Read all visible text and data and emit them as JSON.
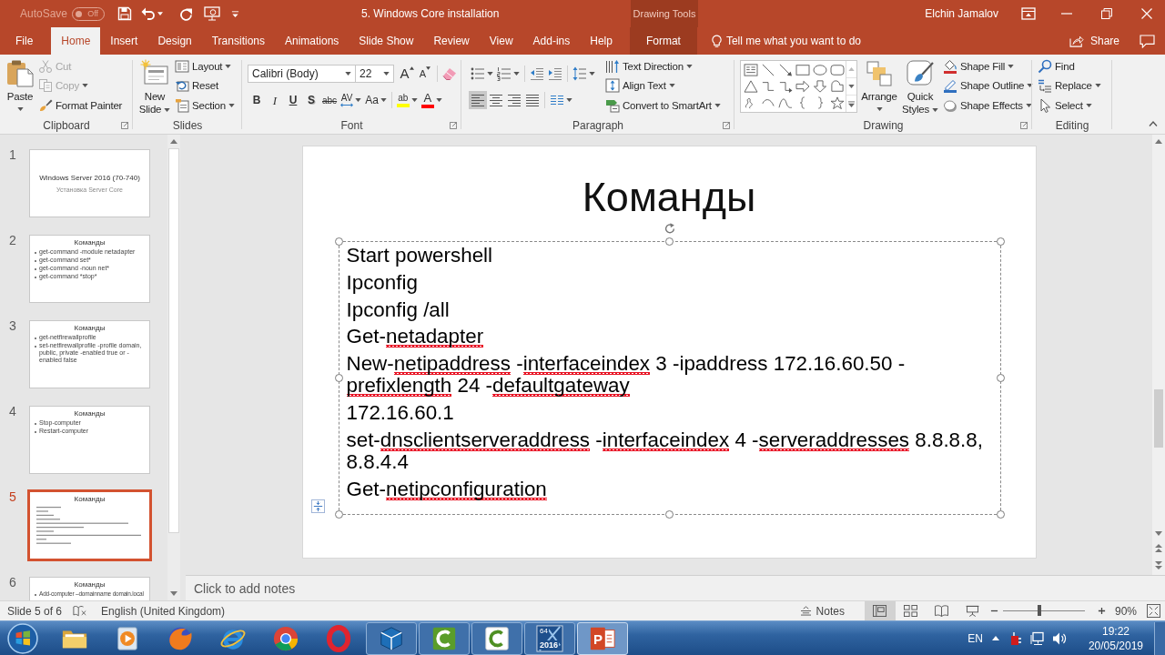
{
  "title_bar": {
    "autosave": {
      "label": "AutoSave",
      "state": "Off",
      "on": false
    },
    "title": "5. Windows Core installation",
    "context_header": "Drawing Tools",
    "user": "Elchin Jamalov"
  },
  "tabs": [
    {
      "label": "File",
      "selected": false,
      "contextual": false
    },
    {
      "label": "Home",
      "selected": true,
      "contextual": false
    },
    {
      "label": "Insert",
      "selected": false,
      "contextual": false
    },
    {
      "label": "Design",
      "selected": false,
      "contextual": false
    },
    {
      "label": "Transitions",
      "selected": false,
      "contextual": false
    },
    {
      "label": "Animations",
      "selected": false,
      "contextual": false
    },
    {
      "label": "Slide Show",
      "selected": false,
      "contextual": false
    },
    {
      "label": "Review",
      "selected": false,
      "contextual": false
    },
    {
      "label": "View",
      "selected": false,
      "contextual": false
    },
    {
      "label": "Add-ins",
      "selected": false,
      "contextual": false
    },
    {
      "label": "Help",
      "selected": false,
      "contextual": false
    },
    {
      "label": "Format",
      "selected": false,
      "contextual": true
    }
  ],
  "tell_me": {
    "placeholder": "Tell me what you want to do"
  },
  "share": {
    "label": "Share"
  },
  "ribbon": {
    "groups": [
      {
        "label": "Clipboard",
        "launcher": true,
        "items": [
          {
            "kind": "large",
            "label": "Paste",
            "dropdown": true,
            "disabled": false
          },
          {
            "kind": "small",
            "label": "Cut",
            "dropdown": false,
            "disabled": true
          },
          {
            "kind": "small",
            "label": "Copy",
            "dropdown": true,
            "disabled": true
          },
          {
            "kind": "small",
            "label": "Format Painter",
            "dropdown": false,
            "disabled": false
          }
        ]
      },
      {
        "label": "Slides",
        "launcher": false,
        "items": [
          {
            "kind": "large",
            "label": "New Slide",
            "dropdown": true
          },
          {
            "kind": "small",
            "label": "Layout",
            "dropdown": true
          },
          {
            "kind": "small",
            "label": "Reset",
            "dropdown": false
          },
          {
            "kind": "small",
            "label": "Section",
            "dropdown": true
          }
        ]
      },
      {
        "label": "Font",
        "launcher": true,
        "items": [
          {
            "kind": "combo",
            "value": "Calibri (Body)",
            "dropdown": true
          },
          {
            "kind": "combo",
            "value": "22",
            "dropdown": true
          },
          {
            "kind": "glyph",
            "text": "A",
            "dropdown": false,
            "selected": false
          },
          {
            "kind": "glyph",
            "text": "A",
            "dropdown": false,
            "selected": false
          },
          {
            "kind": "icon",
            "dropdown": false,
            "selected": false
          },
          {
            "kind": "glyph",
            "text": "B",
            "dropdown": false,
            "selected": false
          },
          {
            "kind": "glyph",
            "text": "I",
            "dropdown": false,
            "selected": false
          },
          {
            "kind": "glyph",
            "text": "U",
            "dropdown": false,
            "selected": false
          },
          {
            "kind": "glyph",
            "text": "S",
            "dropdown": false,
            "selected": false
          },
          {
            "kind": "glyph",
            "text": "abc",
            "dropdown": false,
            "selected": false
          },
          {
            "kind": "glyph",
            "text": "AV",
            "dropdown": true,
            "selected": false
          },
          {
            "kind": "glyph",
            "text": "Aa",
            "dropdown": true,
            "selected": false
          },
          {
            "kind": "glyph",
            "text": "ab",
            "dropdown": true,
            "selected": false,
            "color": "#ffff00"
          },
          {
            "kind": "glyph",
            "text": "A",
            "dropdown": true,
            "selected": false,
            "color": "#ff0000"
          }
        ]
      },
      {
        "label": "Paragraph",
        "launcher": true,
        "items": [
          {
            "kind": "icon",
            "dropdown": true,
            "selected": false
          },
          {
            "kind": "icon",
            "dropdown": true,
            "selected": false
          },
          {
            "kind": "icon",
            "dropdown": false,
            "selected": false
          },
          {
            "kind": "icon",
            "dropdown": false,
            "selected": false
          },
          {
            "kind": "icon",
            "dropdown": true,
            "selected": false
          },
          {
            "kind": "icon",
            "dropdown": false,
            "selected": true
          },
          {
            "kind": "icon",
            "dropdown": false,
            "selected": false
          },
          {
            "kind": "icon",
            "dropdown": false,
            "selected": false
          },
          {
            "kind": "icon",
            "dropdown": false,
            "selected": false
          },
          {
            "kind": "icon",
            "dropdown": true,
            "selected": false
          },
          {
            "kind": "small",
            "label": "Text Direction",
            "dropdown": true
          },
          {
            "kind": "small",
            "label": "Align Text",
            "dropdown": true
          },
          {
            "kind": "small",
            "label": "Convert to SmartArt",
            "dropdown": true
          }
        ]
      },
      {
        "label": "Drawing",
        "launcher": true,
        "items": [
          {
            "kind": "gallery"
          },
          {
            "kind": "large",
            "label": "Arrange",
            "dropdown": true
          },
          {
            "kind": "large",
            "label": "Quick Styles",
            "dropdown": true
          },
          {
            "kind": "small",
            "label": "Shape Fill",
            "dropdown": true
          },
          {
            "kind": "small",
            "label": "Shape Outline",
            "dropdown": true
          },
          {
            "kind": "small",
            "label": "Shape Effects",
            "dropdown": true
          }
        ]
      },
      {
        "label": "Editing",
        "launcher": false,
        "items": [
          {
            "kind": "small",
            "label": "Find",
            "dropdown": false
          },
          {
            "kind": "small",
            "label": "Replace",
            "dropdown": true
          },
          {
            "kind": "small",
            "label": "Select",
            "dropdown": true
          }
        ]
      }
    ]
  },
  "slides_pane": {
    "slides": [
      {
        "number": "1",
        "selected": false,
        "kind": "title",
        "title": "Windows Server 2016 (70-740)",
        "subtitle": "Установка Server Core"
      },
      {
        "number": "2",
        "selected": false,
        "kind": "bullets",
        "title": "Команды",
        "lines": [
          "get-command -module netadapter",
          "get-command set*",
          "get-command -noun net*",
          "get-command *stop*"
        ]
      },
      {
        "number": "3",
        "selected": false,
        "kind": "bullets",
        "title": "Команды",
        "lines": [
          "get-netfirewallprofile",
          "set-netfirewallprofile -profile domain, public, private -enabled true or -enabled false"
        ]
      },
      {
        "number": "4",
        "selected": false,
        "kind": "bullets",
        "title": "Команды",
        "lines": [
          "Stop-computer",
          "Restart-computer"
        ]
      },
      {
        "number": "5",
        "selected": true,
        "kind": "plain",
        "title": "Команды"
      },
      {
        "number": "6",
        "selected": false,
        "kind": "bullets",
        "title": "Команды",
        "lines": [
          "Add-computer –domainname domain.local"
        ]
      }
    ]
  },
  "slide": {
    "title": "Команды",
    "text_box": {
      "selected": true,
      "paragraphs": [
        {
          "lines": [
            {
              "segments": [
                {
                  "text": "Start powershell",
                  "misspelled": false
                }
              ]
            }
          ]
        },
        {
          "lines": [
            {
              "segments": [
                {
                  "text": "Ipconfig",
                  "misspelled": false
                }
              ]
            }
          ]
        },
        {
          "lines": [
            {
              "segments": [
                {
                  "text": "Ipconfig /all",
                  "misspelled": false
                }
              ]
            }
          ]
        },
        {
          "lines": [
            {
              "segments": [
                {
                  "text": "Get-",
                  "misspelled": false
                },
                {
                  "text": "netadapter",
                  "misspelled": true
                }
              ]
            }
          ]
        },
        {
          "lines": [
            {
              "segments": [
                {
                  "text": "New-",
                  "misspelled": false
                },
                {
                  "text": "netipaddress",
                  "misspelled": true
                },
                {
                  "text": " -",
                  "misspelled": false
                },
                {
                  "text": "interfaceindex",
                  "misspelled": true
                },
                {
                  "text": " 3 -ipaddress 172.16.60.50 -",
                  "misspelled": false
                }
              ]
            },
            {
              "segments": [
                {
                  "text": "prefixlength",
                  "misspelled": true
                },
                {
                  "text": " 24 -",
                  "misspelled": false
                },
                {
                  "text": "defaultgateway",
                  "misspelled": true
                }
              ]
            }
          ]
        },
        {
          "lines": [
            {
              "segments": [
                {
                  "text": "172.16.60.1",
                  "misspelled": false
                }
              ]
            }
          ]
        },
        {
          "lines": [
            {
              "segments": [
                {
                  "text": "set-",
                  "misspelled": false
                },
                {
                  "text": "dnsclientserveraddress",
                  "misspelled": true
                },
                {
                  "text": " -",
                  "misspelled": false
                },
                {
                  "text": "interfaceindex",
                  "misspelled": true
                },
                {
                  "text": " 4 -",
                  "misspelled": false
                },
                {
                  "text": "serveraddresses",
                  "misspelled": true
                },
                {
                  "text": " 8.8.8.8,",
                  "misspelled": false
                }
              ]
            },
            {
              "segments": [
                {
                  "text": "8.8.4.4",
                  "misspelled": false
                }
              ]
            }
          ]
        },
        {
          "lines": [
            {
              "segments": [
                {
                  "text": "Get-",
                  "misspelled": false
                },
                {
                  "text": "netipconfiguration",
                  "misspelled": true
                }
              ]
            }
          ]
        }
      ]
    }
  },
  "notes": {
    "placeholder": "Click to add notes"
  },
  "status_bar": {
    "slide_info": "Slide 5 of 6",
    "language": "English (United Kingdom)",
    "notes_label": "Notes",
    "views": [
      {
        "selected": true
      },
      {
        "selected": false
      },
      {
        "selected": false
      },
      {
        "selected": false
      }
    ],
    "zoom": {
      "level": 0.45,
      "value": "90%"
    }
  },
  "taskbar": {
    "apps": [
      {
        "kind": "folder",
        "running": false,
        "selected": false
      },
      {
        "kind": "player",
        "running": false,
        "selected": false
      },
      {
        "kind": "fox",
        "running": false,
        "selected": false
      },
      {
        "kind": "e-globe",
        "running": false,
        "selected": false
      },
      {
        "kind": "tri-ring",
        "running": false,
        "selected": false
      },
      {
        "kind": "o-ring",
        "running": false,
        "selected": false
      },
      {
        "kind": "cube",
        "running": true,
        "selected": false
      },
      {
        "kind": "c-tile",
        "running": true,
        "selected": false
      },
      {
        "kind": "c-tile-light",
        "running": true,
        "selected": false
      },
      {
        "kind": "x-tile",
        "running": true,
        "selected": false,
        "badge": "64",
        "caption": "2016"
      },
      {
        "kind": "p-tile",
        "running": true,
        "selected": true,
        "glyph": "P"
      }
    ],
    "language": "EN",
    "time": "19:22",
    "date": "20/05/2019"
  }
}
